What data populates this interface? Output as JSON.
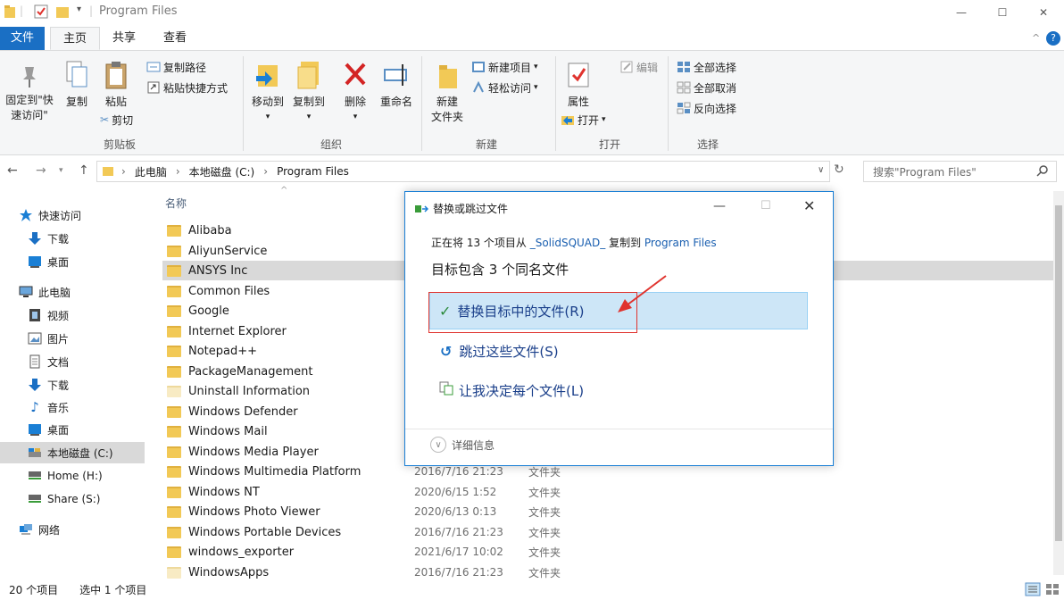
{
  "window": {
    "title": "Program Files",
    "minimize": "—",
    "maximize": "☐",
    "close": "✕"
  },
  "ribbon_tabs": [
    "文件",
    "主页",
    "共享",
    "查看"
  ],
  "ribbon": {
    "pin_label_1": "固定到\"快",
    "pin_label_2": "速访问\"",
    "copy": "复制",
    "paste": "粘贴",
    "copy_path": "复制路径",
    "paste_shortcut": "粘贴快捷方式",
    "cut": "剪切",
    "clipboard_group": "剪贴板",
    "move_to": "移动到",
    "copy_to": "复制到",
    "delete": "删除",
    "rename": "重命名",
    "organize_group": "组织",
    "new_folder_1": "新建",
    "new_folder_2": "文件夹",
    "new_item": "新建项目",
    "easy_access": "轻松访问",
    "new_group": "新建",
    "properties": "属性",
    "open": "打开",
    "edit": "编辑",
    "open_group": "打开",
    "select_all": "全部选择",
    "select_none": "全部取消",
    "invert_selection": "反向选择",
    "select_group": "选择"
  },
  "address": {
    "crumbs": [
      "此电脑",
      "本地磁盘 (C:)",
      "Program Files"
    ],
    "search_placeholder": "搜索\"Program Files\""
  },
  "nav": [
    {
      "label": "快速访问",
      "icon": "star-icon"
    },
    {
      "label": "下载",
      "icon": "download-icon"
    },
    {
      "label": "桌面",
      "icon": "desktop-icon"
    },
    {
      "label": "此电脑",
      "icon": "computer-icon"
    },
    {
      "label": "视频",
      "icon": "video-icon"
    },
    {
      "label": "图片",
      "icon": "picture-icon"
    },
    {
      "label": "文档",
      "icon": "document-icon"
    },
    {
      "label": "下载",
      "icon": "download-icon"
    },
    {
      "label": "音乐",
      "icon": "music-icon"
    },
    {
      "label": "桌面",
      "icon": "desktop-icon"
    },
    {
      "label": "本地磁盘 (C:)",
      "icon": "drive-icon"
    },
    {
      "label": "Home (H:)",
      "icon": "network-drive-icon"
    },
    {
      "label": "Share (S:)",
      "icon": "network-drive-icon"
    },
    {
      "label": "网络",
      "icon": "network-icon"
    }
  ],
  "list_header": "名称",
  "files": [
    {
      "name": "Alibaba",
      "date": "",
      "type": ""
    },
    {
      "name": "AliyunService",
      "date": "",
      "type": ""
    },
    {
      "name": "ANSYS Inc",
      "date": "",
      "type": ""
    },
    {
      "name": "Common Files",
      "date": "",
      "type": ""
    },
    {
      "name": "Google",
      "date": "",
      "type": ""
    },
    {
      "name": "Internet Explorer",
      "date": "",
      "type": ""
    },
    {
      "name": "Notepad++",
      "date": "",
      "type": ""
    },
    {
      "name": "PackageManagement",
      "date": "",
      "type": ""
    },
    {
      "name": "Uninstall Information",
      "date": "",
      "type": ""
    },
    {
      "name": "Windows Defender",
      "date": "",
      "type": ""
    },
    {
      "name": "Windows Mail",
      "date": "",
      "type": ""
    },
    {
      "name": "Windows Media Player",
      "date": "",
      "type": ""
    },
    {
      "name": "Windows Multimedia Platform",
      "date": "2016/7/16 21:23",
      "type": "文件夹"
    },
    {
      "name": "Windows NT",
      "date": "2020/6/15 1:52",
      "type": "文件夹"
    },
    {
      "name": "Windows Photo Viewer",
      "date": "2020/6/13 0:13",
      "type": "文件夹"
    },
    {
      "name": "Windows Portable Devices",
      "date": "2016/7/16 21:23",
      "type": "文件夹"
    },
    {
      "name": "windows_exporter",
      "date": "2021/6/17 10:02",
      "type": "文件夹"
    },
    {
      "name": "WindowsApps",
      "date": "2016/7/16 21:23",
      "type": "文件夹"
    }
  ],
  "status": {
    "count": "20 个项目",
    "selected": "选中 1 个项目"
  },
  "dialog": {
    "title": "替换或跳过文件",
    "line_prefix": "正在将 13 个项目从 ",
    "source": "_SolidSQUAD_",
    "line_middle": " 复制到 ",
    "dest": "Program Files",
    "subtitle": "目标包含 3 个同名文件",
    "replace": "替换目标中的文件(R)",
    "skip": "跳过这些文件(S)",
    "decide": "让我决定每个文件(L)",
    "details": "详细信息"
  },
  "colors": {
    "accent": "#1a6fc4",
    "highlight": "#cde6f7",
    "annotation_red": "#e0332e"
  }
}
